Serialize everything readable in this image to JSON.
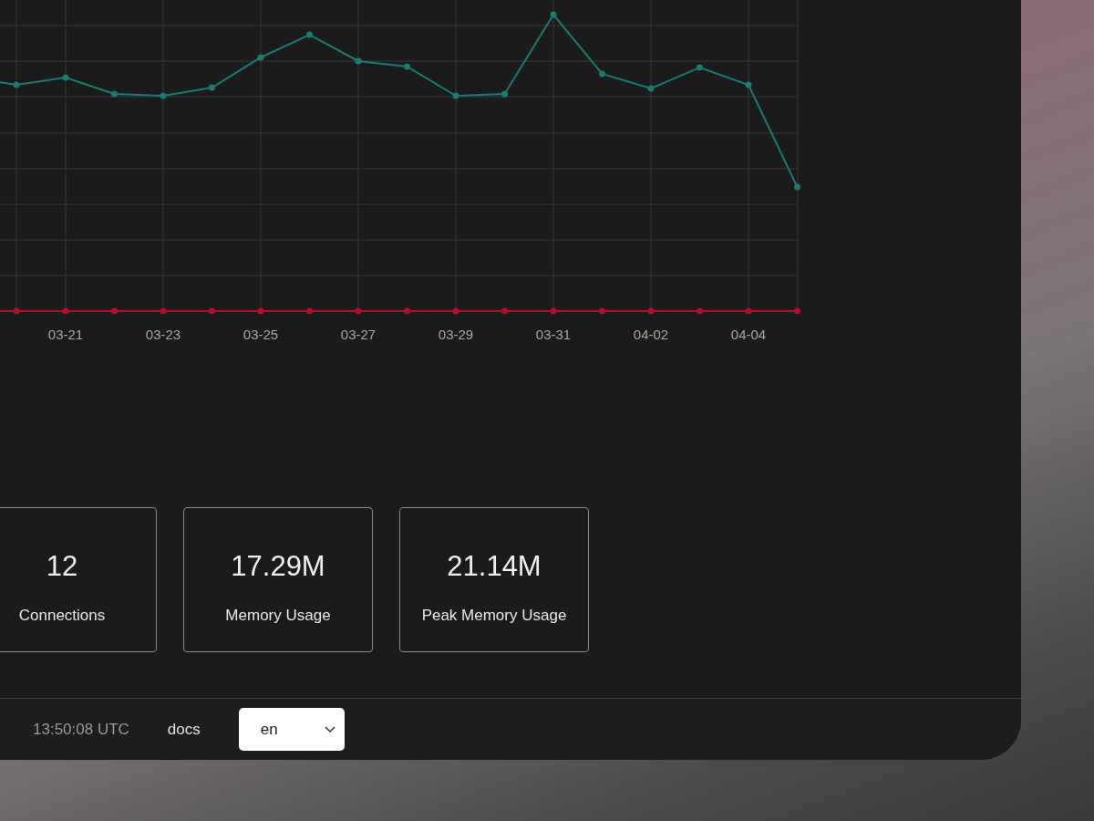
{
  "chart": {
    "x_labels": [
      "03-21",
      "03-23",
      "03-25",
      "03-27",
      "03-29",
      "03-31",
      "04-02",
      "04-04"
    ]
  },
  "stats": [
    {
      "value": "12",
      "label": "Connections"
    },
    {
      "value": "17.29M",
      "label": "Memory Usage"
    },
    {
      "value": "21.14M",
      "label": "Peak Memory Usage"
    }
  ],
  "footer": {
    "time": "13:50:08 UTC",
    "docs_link": "docs",
    "language_select": {
      "value": "en"
    }
  }
}
